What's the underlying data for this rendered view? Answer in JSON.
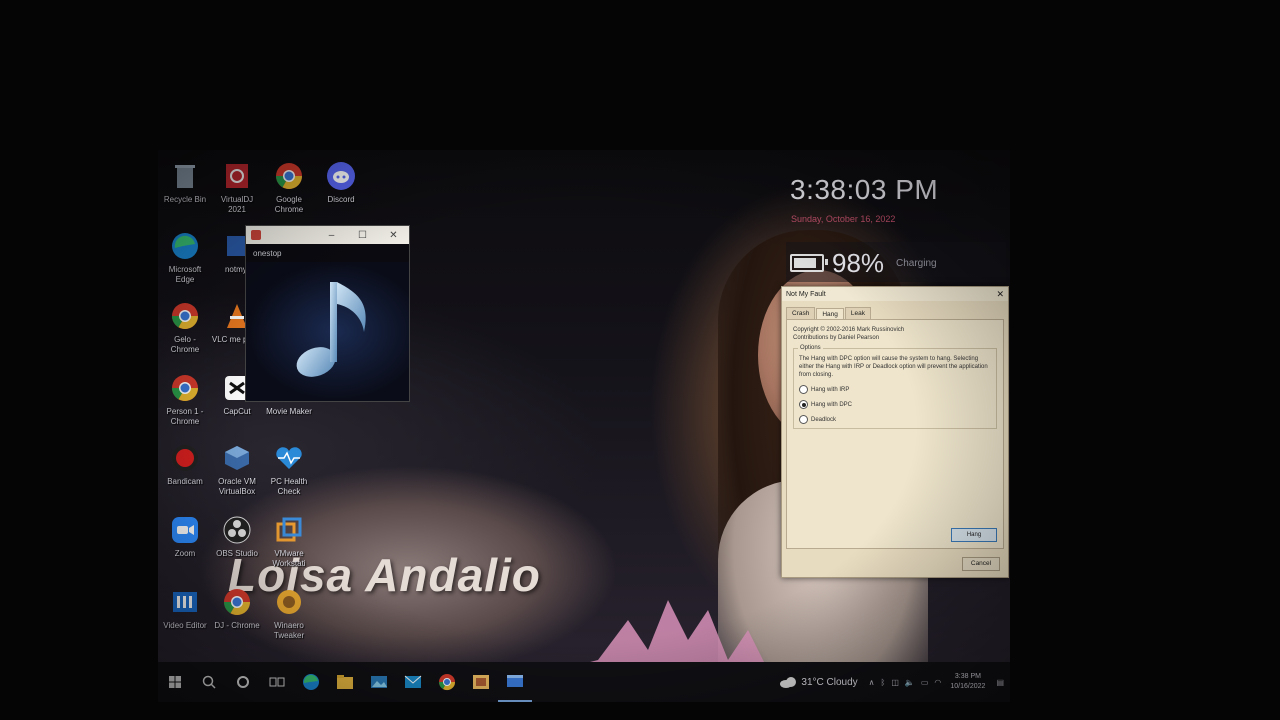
{
  "desktop": {
    "icons": [
      {
        "label": "Recycle Bin",
        "icon": "recycle-bin-icon"
      },
      {
        "label": "VirtualDJ 2021",
        "icon": "virtualdj-icon"
      },
      {
        "label": "Google Chrome",
        "icon": "chrome-icon"
      },
      {
        "label": "Discord",
        "icon": "discord-icon"
      },
      {
        "label": "Microsoft Edge",
        "icon": "edge-icon"
      },
      {
        "label": "notmyf",
        "icon": "notmyfault-icon"
      },
      {
        "label": "Gelo - Chrome",
        "icon": "chrome-icon"
      },
      {
        "label": "VLC me playe",
        "icon": "vlc-icon"
      },
      {
        "label": "Person 1 - Chrome",
        "icon": "chrome-icon"
      },
      {
        "label": "CapCut",
        "icon": "capcut-icon"
      },
      {
        "label": "Movie Maker",
        "icon": "movie-maker-icon"
      },
      {
        "label": "Bandicam",
        "icon": "bandicam-icon"
      },
      {
        "label": "Oracle VM VirtualBox",
        "icon": "virtualbox-icon"
      },
      {
        "label": "PC Health Check",
        "icon": "pc-health-icon"
      },
      {
        "label": "Zoom",
        "icon": "zoom-icon"
      },
      {
        "label": "OBS Studio",
        "icon": "obs-icon"
      },
      {
        "label": "VMware Workstati",
        "icon": "vmware-icon"
      },
      {
        "label": "Video Editor",
        "icon": "video-editor-icon"
      },
      {
        "label": "DJ - Chrome",
        "icon": "chrome-icon"
      },
      {
        "label": "Winaero Tweaker",
        "icon": "winaero-icon"
      }
    ],
    "banner_text": "Loisa Andalio"
  },
  "clock_widget": {
    "time": "3:38:03 PM",
    "date": "Sunday, October 16, 2022",
    "battery_percent": "98%",
    "battery_level": 0.98,
    "battery_state": "Charging"
  },
  "player_window": {
    "name": "onestop",
    "controls": {
      "minimize": "–",
      "maximize": "☐",
      "close": "✕"
    }
  },
  "dialog": {
    "title": "Not My Fault",
    "close": "✕",
    "tabs": [
      {
        "label": "Crash"
      },
      {
        "label": "Hang"
      },
      {
        "label": "Leak"
      }
    ],
    "active_tab": "Hang",
    "copyright": "Copyright © 2002-2016 Mark Russinovich",
    "contributions": "Contributions by Daniel Pearson",
    "options_legend": "Options",
    "description": "The Hang with DPC option will cause the system to hang. Selecting either the Hang with IRP or Deadlock option will prevent the application from closing.",
    "options": [
      {
        "label": "Hang with IRP",
        "selected": false
      },
      {
        "label": "Hang with DPC",
        "selected": true
      },
      {
        "label": "Deadlock",
        "selected": false
      }
    ],
    "hang_button": "Hang",
    "cancel_button": "Cancel"
  },
  "taskbar": {
    "weather": "31°C Cloudy",
    "time": "3:38 PM",
    "date": "10/16/2022",
    "apps": [
      "start-icon",
      "search-icon",
      "cortana-icon",
      "task-view-icon",
      "edge-icon",
      "file-explorer-icon",
      "photos-icon",
      "mail-icon",
      "chrome-icon",
      "player-icon",
      "notmyfault-icon"
    ]
  },
  "colors": {
    "taskbar": "#101014",
    "dialog_bg": "#e8dcc0",
    "date_accent": "#c0506a",
    "active_accent": "#7aa8e0"
  }
}
